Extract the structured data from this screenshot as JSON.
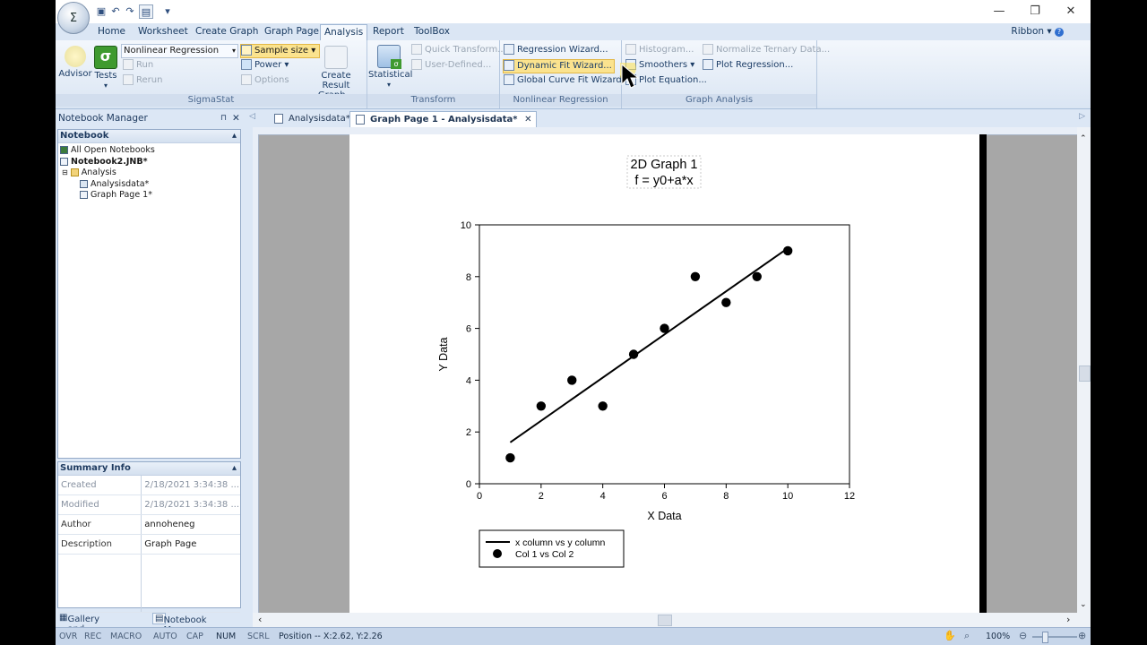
{
  "titlebar": {
    "orb_glyph": "Σ",
    "qat_icons": [
      "save-icon",
      "undo-icon",
      "redo-icon",
      "print-icon"
    ],
    "customize_glyph": "▾",
    "minimize_glyph": "—",
    "restore_glyph": "❐",
    "close_glyph": "✕"
  },
  "menu_tabs": [
    "Home",
    "Worksheet",
    "Create Graph",
    "Graph Page",
    "Analysis",
    "Report",
    "ToolBox"
  ],
  "active_tab": "Analysis",
  "ribbon_label": "Ribbon",
  "ribbon": {
    "sigmastat": {
      "label": "SigmaStat",
      "advisor": "Advisor",
      "tests": "Tests",
      "test_select": "Nonlinear Regression",
      "run": "Run",
      "rerun": "Rerun",
      "sample_size": "Sample size",
      "power": "Power",
      "options": "Options",
      "create_result": "Create Result",
      "create_result2": "Graph..."
    },
    "transform": {
      "label": "Transform",
      "statistical": "Statistical",
      "quick_transform": "Quick Transform...",
      "user_defined": "User-Defined..."
    },
    "nonlinear": {
      "label": "Nonlinear Regression",
      "regression_wizard": "Regression Wizard...",
      "dynamic_fit": "Dynamic Fit Wizard...",
      "global_curve": "Global Curve Fit Wizard..."
    },
    "graph_analysis": {
      "label": "Graph Analysis",
      "histogram": "Histogram...",
      "smoothers": "Smoothers",
      "plot_equation": "Plot Equation...",
      "normalize_ternary": "Normalize Ternary Data...",
      "plot_regression": "Plot Regression..."
    }
  },
  "notebook_manager": {
    "title": "Notebook Manager",
    "pin_glyph": "⊓",
    "close_glyph": "✕",
    "section": "Notebook",
    "tree": [
      "All Open Notebooks",
      "Notebook2.JNB*",
      "Analysis",
      "Analysisdata*",
      "Graph Page 1*"
    ],
    "summary_title": "Summary Info",
    "summary": [
      {
        "key": "Created",
        "value": "2/18/2021 3:34:38 ..."
      },
      {
        "key": "Modified",
        "value": "2/18/2021 3:34:38 ..."
      },
      {
        "key": "Author",
        "value": "annoheneg"
      },
      {
        "key": "Description",
        "value": "Graph Page"
      }
    ],
    "bottom_tabs": [
      "Gallery and Templ...",
      "Notebook Manager"
    ]
  },
  "doc_tabs": [
    "Analysisdata*",
    "Graph Page 1 - Analysisdata*"
  ],
  "graph": {
    "title_line1": "2D Graph 1",
    "title_line2": "f = y0+a*x",
    "legend_line": "x column vs y column",
    "legend_points": "Col 1 vs Col 2"
  },
  "chart_data": {
    "type": "scatter",
    "title": "2D Graph 1",
    "subtitle": "f = y0+a*x",
    "xlabel": "X Data",
    "ylabel": "Y Data",
    "xlim": [
      0,
      12
    ],
    "ylim": [
      0,
      10
    ],
    "xticks": [
      0,
      2,
      4,
      6,
      8,
      10,
      12
    ],
    "yticks": [
      0,
      2,
      4,
      6,
      8,
      10
    ],
    "grid": false,
    "legend_position": "bottom-left below plot",
    "series": [
      {
        "name": "Col 1 vs Col 2",
        "kind": "scatter",
        "x": [
          1,
          2,
          3,
          4,
          5,
          6,
          7,
          8,
          9,
          10
        ],
        "y": [
          1,
          3,
          4,
          3,
          5,
          6,
          8,
          7,
          8,
          9
        ]
      },
      {
        "name": "x column vs y column",
        "kind": "line",
        "x": [
          1,
          10
        ],
        "y": [
          1.6,
          9.1
        ]
      }
    ]
  },
  "status": {
    "indicators": [
      "OVR",
      "REC",
      "MACRO",
      "AUTO",
      "CAP",
      "NUM",
      "SCRL"
    ],
    "position": "Position -- X:2.62, Y:2.26",
    "zoom": "100%"
  }
}
